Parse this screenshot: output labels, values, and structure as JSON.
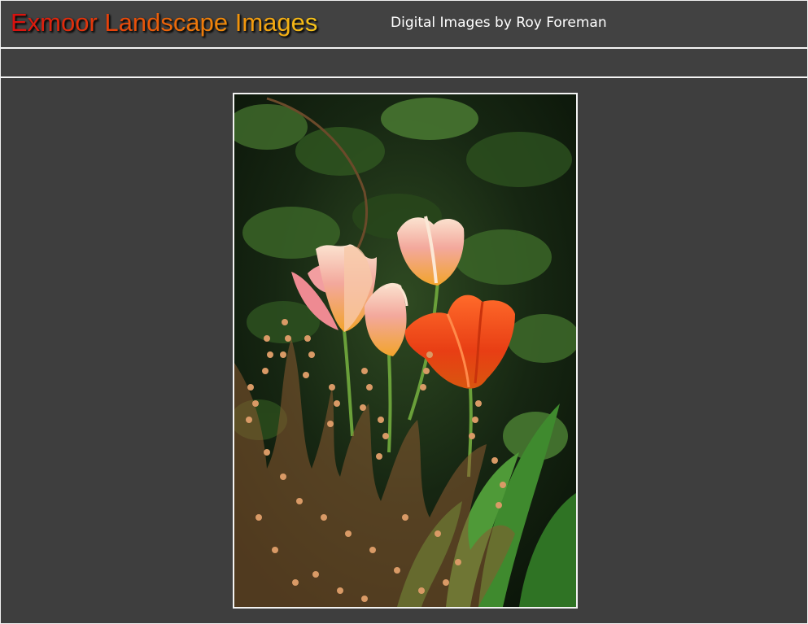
{
  "header": {
    "title": "Exmoor Landscape Images",
    "subtitle": "Digital Images by Roy Foreman"
  },
  "colors": {
    "background": "#3e3e3e",
    "rule": "#f4f4f4",
    "title_gradient_start": "#d90f0f",
    "title_gradient_end": "#f7c51a",
    "subtitle_text": "#ffffff"
  },
  "photo": {
    "subject": "tulips-and-heather-photo"
  }
}
